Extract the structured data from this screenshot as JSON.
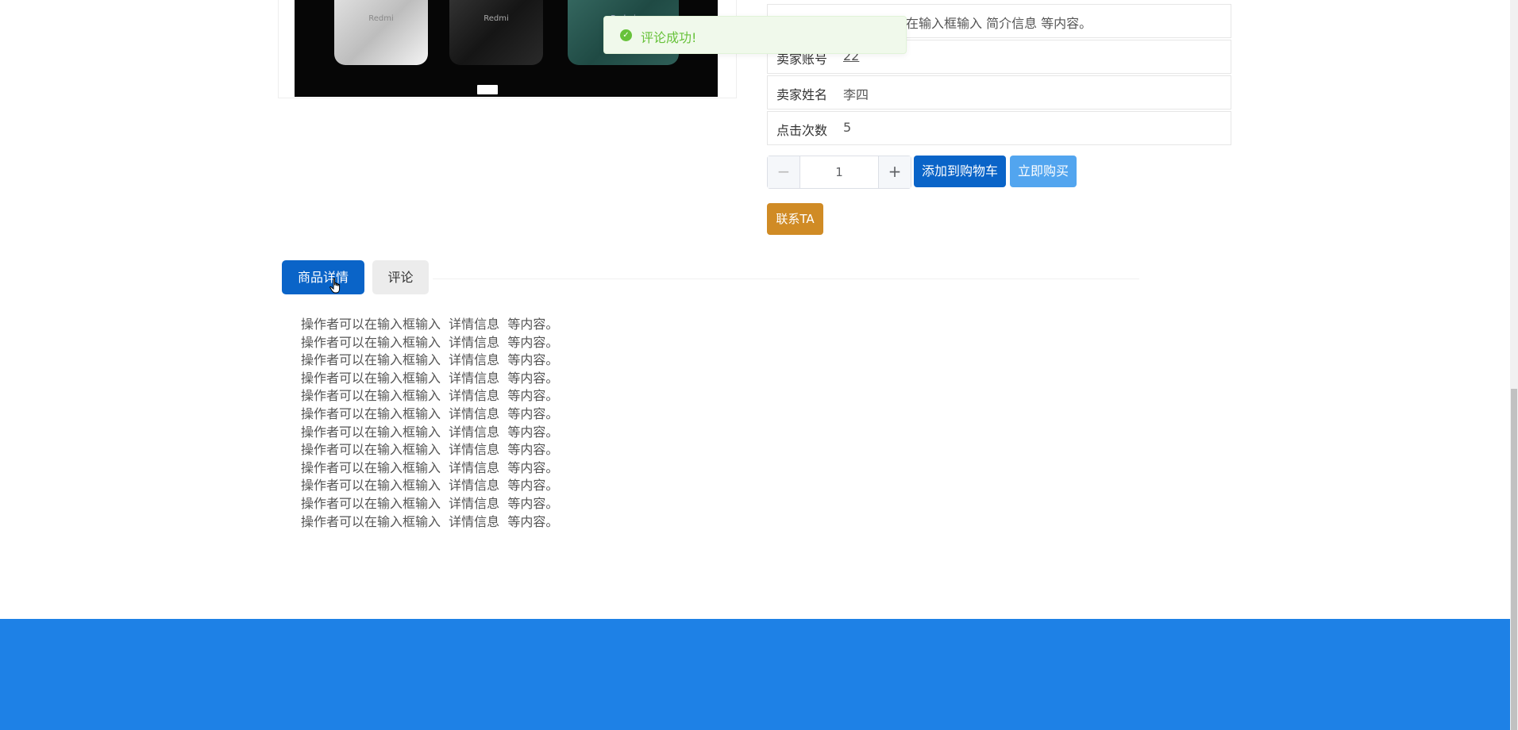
{
  "toast": {
    "message": "评论成功!"
  },
  "product_image": {
    "brand_text": "Redmi"
  },
  "info": {
    "intro_value": "在输入框输入 简介信息 等内容。",
    "rows": [
      {
        "label": "卖家账号",
        "value": "22"
      },
      {
        "label": "卖家姓名",
        "value": "李四"
      },
      {
        "label": "点击次数",
        "value": "5"
      }
    ]
  },
  "quantity": {
    "minus": "−",
    "value": "1",
    "plus": "+"
  },
  "buttons": {
    "add_to_cart": "添加到购物车",
    "buy_now": "立即购买",
    "contact": "联系TA"
  },
  "tabs": [
    {
      "label": "商品详情",
      "active": true
    },
    {
      "label": "评论",
      "active": false
    }
  ],
  "details": {
    "lines": [
      "操作者可以在输入框输入  详情信息  等内容。",
      "操作者可以在输入框输入  详情信息  等内容。",
      "操作者可以在输入框输入  详情信息  等内容。",
      "操作者可以在输入框输入  详情信息  等内容。",
      "操作者可以在输入框输入  详情信息  等内容。",
      "操作者可以在输入框输入  详情信息  等内容。",
      "操作者可以在输入框输入  详情信息  等内容。",
      "操作者可以在输入框输入  详情信息  等内容。",
      "操作者可以在输入框输入  详情信息  等内容。",
      "操作者可以在输入框输入  详情信息  等内容。",
      "操作者可以在输入框输入  详情信息  等内容。",
      "操作者可以在输入框输入  详情信息  等内容。"
    ]
  },
  "colors": {
    "primary": "#0a64c8",
    "buy": "#52a5ef",
    "contact": "#d08b25",
    "footer": "#1e81e6",
    "success": "#67c23a"
  }
}
